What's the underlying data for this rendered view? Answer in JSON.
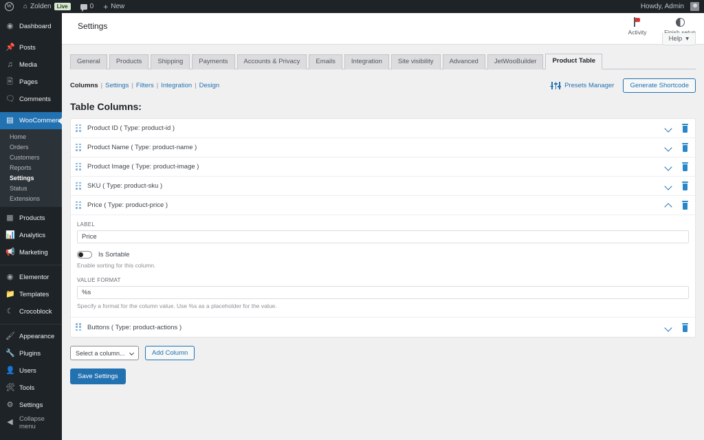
{
  "adminbar": {
    "logo_icon": "wordpress-logo-icon",
    "home_icon": "home-icon",
    "site_name": "Zolden",
    "live_badge": "Live",
    "comments_icon": "comment-bubble-icon",
    "comment_count": "0",
    "new_icon": "plus-icon",
    "new_label": "New",
    "howdy": "Howdy, Admin",
    "avatar": "avatar"
  },
  "sidebar": {
    "items": [
      {
        "label": "Dashboard",
        "icon": "dashboard-icon"
      },
      {
        "label": "Posts",
        "icon": "pin-icon"
      },
      {
        "label": "Media",
        "icon": "media-icon"
      },
      {
        "label": "Pages",
        "icon": "page-icon"
      },
      {
        "label": "Comments",
        "icon": "comment-icon"
      },
      {
        "label": "WooCommerce",
        "icon": "woocommerce-icon",
        "current": true
      },
      {
        "label": "Products",
        "icon": "products-icon"
      },
      {
        "label": "Analytics",
        "icon": "analytics-icon"
      },
      {
        "label": "Marketing",
        "icon": "marketing-icon"
      },
      {
        "label": "Elementor",
        "icon": "elementor-icon"
      },
      {
        "label": "Templates",
        "icon": "templates-icon"
      },
      {
        "label": "Crocoblock",
        "icon": "crocoblock-icon"
      },
      {
        "label": "Appearance",
        "icon": "appearance-icon"
      },
      {
        "label": "Plugins",
        "icon": "plugins-icon"
      },
      {
        "label": "Users",
        "icon": "users-icon"
      },
      {
        "label": "Tools",
        "icon": "tools-icon"
      },
      {
        "label": "Settings",
        "icon": "settings-icon"
      },
      {
        "label": "Collapse menu",
        "icon": "collapse-icon"
      }
    ],
    "woocommerce_submenu": [
      {
        "label": "Home"
      },
      {
        "label": "Orders"
      },
      {
        "label": "Customers"
      },
      {
        "label": "Reports"
      },
      {
        "label": "Settings",
        "current": true
      },
      {
        "label": "Status"
      },
      {
        "label": "Extensions"
      }
    ]
  },
  "pagehead": {
    "title": "Settings",
    "actions": [
      {
        "label": "Activity",
        "icon": "flag-icon"
      },
      {
        "label": "Finish setup",
        "icon": "half-circle-icon"
      }
    ],
    "help_label": "Help",
    "help_caret": "chevron-down-icon"
  },
  "tabs": [
    {
      "label": "General"
    },
    {
      "label": "Products"
    },
    {
      "label": "Shipping"
    },
    {
      "label": "Payments"
    },
    {
      "label": "Accounts & Privacy"
    },
    {
      "label": "Emails"
    },
    {
      "label": "Integration"
    },
    {
      "label": "Site visibility"
    },
    {
      "label": "Advanced"
    },
    {
      "label": "JetWooBuilder"
    },
    {
      "label": "Product Table",
      "active": true
    }
  ],
  "subnav": {
    "items": [
      {
        "label": "Columns",
        "current": true
      },
      {
        "label": "Settings"
      },
      {
        "label": "Filters"
      },
      {
        "label": "Integration"
      },
      {
        "label": "Design"
      }
    ],
    "separator": "|",
    "presets_label": "Presets Manager",
    "presets_icon": "sliders-icon",
    "generate_shortcode_label": "Generate Shortcode"
  },
  "main": {
    "section_title": "Table Columns:",
    "columns": [
      {
        "label": "Product ID ( Type: product-id )",
        "expanded": false
      },
      {
        "label": "Product Name ( Type: product-name )",
        "expanded": false
      },
      {
        "label": "Product Image ( Type: product-image )",
        "expanded": false
      },
      {
        "label": "SKU ( Type: product-sku )",
        "expanded": false
      },
      {
        "label": "Price ( Type: product-price )",
        "expanded": true
      },
      {
        "label": "Buttons ( Type: product-actions )",
        "expanded": false
      }
    ],
    "price_panel": {
      "label_field_label": "LABEL",
      "label_field_value": "Price",
      "sortable_toggle_label": "Is Sortable",
      "sortable_toggle_state": "off",
      "sortable_help": "Enable sorting for this column.",
      "format_field_label": "VALUE FORMAT",
      "format_field_value": "%s",
      "format_help": "Specify a format for the column value. Use %s as a placeholder for the value."
    },
    "add_column_select": "Select a column...",
    "add_column_button": "Add Column",
    "save_button": "Save Settings"
  },
  "colors": {
    "admin_dark": "#1d2327",
    "wp_blue": "#2271b1",
    "page_bg": "#f0f0f1",
    "trash_blue": "#2986c9",
    "handle_blue": "#8ab6d9",
    "live_green": "#d7e7d0"
  }
}
